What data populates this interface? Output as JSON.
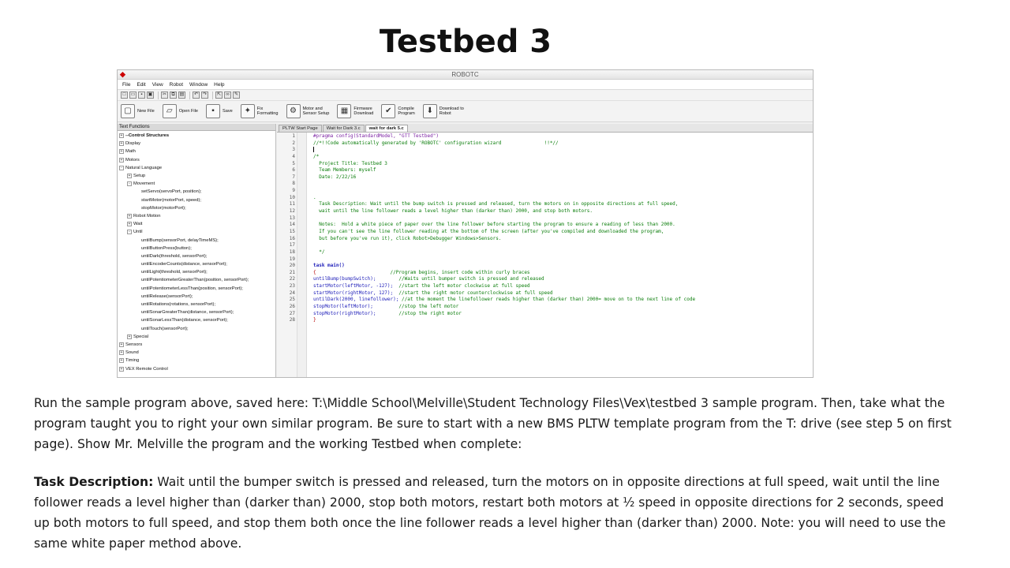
{
  "slide": {
    "title": "Testbed 3"
  },
  "app": {
    "title": "ROBOTC",
    "menu": [
      "File",
      "Edit",
      "View",
      "Robot",
      "Window",
      "Help"
    ],
    "toolbar_buttons": [
      {
        "label": "New File",
        "icon": "new-file-icon"
      },
      {
        "label": "Open File",
        "icon": "open-file-icon"
      },
      {
        "label": "Save",
        "icon": "save-icon"
      },
      {
        "label": "Fix\nFormatting",
        "icon": "fix-formatting-icon"
      },
      {
        "label": "Motor and\nSensor Setup",
        "icon": "motor-sensor-icon"
      },
      {
        "label": "Firmware\nDownload",
        "icon": "firmware-icon"
      },
      {
        "label": "Compile\nProgram",
        "icon": "compile-icon"
      },
      {
        "label": "Download to\nRobot",
        "icon": "download-icon"
      }
    ],
    "panel_header": "Text Functions",
    "tree": [
      {
        "label": "--Control Structures",
        "indent": 0,
        "toggle": "+",
        "bold": true
      },
      {
        "label": "Display",
        "indent": 0,
        "toggle": "+"
      },
      {
        "label": "Math",
        "indent": 0,
        "toggle": "+"
      },
      {
        "label": "Motors",
        "indent": 0,
        "toggle": "+"
      },
      {
        "label": "Natural Language",
        "indent": 0,
        "toggle": "-"
      },
      {
        "label": "Setup",
        "indent": 1,
        "toggle": "+"
      },
      {
        "label": "Movement",
        "indent": 1,
        "toggle": "-"
      },
      {
        "label": "setServo(servoPort, position);",
        "indent": 2,
        "toggle": ""
      },
      {
        "label": "startMotor(motorPort, speed);",
        "indent": 2,
        "toggle": ""
      },
      {
        "label": "stopMotor(motorPort);",
        "indent": 2,
        "toggle": ""
      },
      {
        "label": "Robot Motion",
        "indent": 1,
        "toggle": "+"
      },
      {
        "label": "Wait",
        "indent": 1,
        "toggle": "+"
      },
      {
        "label": "Until",
        "indent": 1,
        "toggle": "-"
      },
      {
        "label": "untilBump(sensorPort, delayTimeMS);",
        "indent": 2,
        "toggle": ""
      },
      {
        "label": "untilButtonPress(button);",
        "indent": 2,
        "toggle": ""
      },
      {
        "label": "untilDark(threshold, sensorPort);",
        "indent": 2,
        "toggle": ""
      },
      {
        "label": "untilEncoderCounts(distance, sensorPort);",
        "indent": 2,
        "toggle": ""
      },
      {
        "label": "untilLight(threshold, sensorPort);",
        "indent": 2,
        "toggle": ""
      },
      {
        "label": "untilPotentiometerGreaterThan(position, sensorPort);",
        "indent": 2,
        "toggle": ""
      },
      {
        "label": "untilPotentiometerLessThan(position, sensorPort);",
        "indent": 2,
        "toggle": ""
      },
      {
        "label": "untilRelease(sensorPort);",
        "indent": 2,
        "toggle": ""
      },
      {
        "label": "untilRotations(rotations, sensorPort);",
        "indent": 2,
        "toggle": ""
      },
      {
        "label": "untilSonarGreaterThan(distance, sensorPort);",
        "indent": 2,
        "toggle": ""
      },
      {
        "label": "untilSonarLessThan(distance, sensorPort);",
        "indent": 2,
        "toggle": ""
      },
      {
        "label": "untilTouch(sensorPort);",
        "indent": 2,
        "toggle": ""
      },
      {
        "label": "Special",
        "indent": 1,
        "toggle": "+"
      },
      {
        "label": "Sensors",
        "indent": 0,
        "toggle": "+"
      },
      {
        "label": "Sound",
        "indent": 0,
        "toggle": "+"
      },
      {
        "label": "Timing",
        "indent": 0,
        "toggle": "+"
      },
      {
        "label": "VEX Remote Control",
        "indent": 0,
        "toggle": "+"
      }
    ],
    "tabs": [
      {
        "label": "PLTW Start Page",
        "active": false
      },
      {
        "label": "Wait for Dark 3.c",
        "active": false
      },
      {
        "label": "wait for dark 5.c",
        "active": true
      }
    ],
    "code": [
      {
        "n": "1",
        "cls": "k-directive",
        "text": "#pragma config(StandardModel, \"GTT Testbed\")"
      },
      {
        "n": "2",
        "cls": "k-comment",
        "text": "//*!!Code automatically generated by 'ROBOTC' configuration wizard               !!*//"
      },
      {
        "n": "3",
        "cls": "cursor",
        "text": ""
      },
      {
        "n": "4",
        "cls": "k-comment",
        "text": "/*"
      },
      {
        "n": "5",
        "cls": "k-comment",
        "text": "  Project Title: Testbed 3"
      },
      {
        "n": "6",
        "cls": "k-comment",
        "text": "  Team Members: myself"
      },
      {
        "n": "7",
        "cls": "k-comment",
        "text": "  Date: 2/22/16"
      },
      {
        "n": "8",
        "cls": "k-comment",
        "text": ""
      },
      {
        "n": "9",
        "cls": "k-comment",
        "text": ""
      },
      {
        "n": "10",
        "cls": "k-comment",
        "text": "."
      },
      {
        "n": "11",
        "cls": "k-comment",
        "text": "  Task Description: Wait until the bump switch is pressed and released, turn the motors on in opposite directions at full speed,"
      },
      {
        "n": "12",
        "cls": "k-comment",
        "text": "  wait until the line follower reads a level higher than (darker than) 2000, and stop both motors."
      },
      {
        "n": "13",
        "cls": "k-comment",
        "text": ""
      },
      {
        "n": "14",
        "cls": "k-comment",
        "text": "  Notes:  Hold a white piece of paper over the line follower before starting the program to ensure a reading of less than 2000."
      },
      {
        "n": "15",
        "cls": "k-comment",
        "text": "  If you can't see the line follower reading at the bottom of the screen (after you've compiled and downloaded the program,"
      },
      {
        "n": "16",
        "cls": "k-comment",
        "text": "  but before you've run it), click Robot>Debugger Windows>Sensors."
      },
      {
        "n": "17",
        "cls": "k-comment",
        "text": ""
      },
      {
        "n": "18",
        "cls": "k-comment",
        "text": "  */"
      },
      {
        "n": "19",
        "cls": "k-comment",
        "text": ""
      },
      {
        "n": "20",
        "cls": "k-keyword",
        "text": "task main()"
      },
      {
        "n": "21",
        "cls": "mixed",
        "code": "{",
        "comment": "                          //Program begins, insert code within curly braces"
      },
      {
        "n": "22",
        "cls": "mixed",
        "code": "untilBump(bumpSwitch);",
        "comment": "        //Waits until bumper switch is pressed and released"
      },
      {
        "n": "23",
        "cls": "mixed",
        "code": "startMotor(leftMotor, -127);",
        "comment": "  //start the left motor clockwise at full speed"
      },
      {
        "n": "24",
        "cls": "mixed",
        "code": "startMotor(rightMotor, 127);",
        "comment": "  //start the right motor counterclockwise at full speed"
      },
      {
        "n": "25",
        "cls": "mixed",
        "code": "untilDark(2000, linefollower);",
        "comment": " //at the moment the linefollower reads higher than (darker than) 2000= move on to the next line of code"
      },
      {
        "n": "26",
        "cls": "mixed",
        "code": "stopMotor(leftMotor);",
        "comment": "         //stop the left motor"
      },
      {
        "n": "27",
        "cls": "mixed",
        "code": "stopMotor(rightMotor);",
        "comment": "        //stop the right motor"
      },
      {
        "n": "28",
        "cls": "k-plain",
        "text": "}"
      }
    ]
  },
  "body": {
    "para1": "Run the sample program above, saved here:  T:\\Middle School\\Melville\\Student Technology Files\\Vex\\testbed 3 sample program. Then, take what the program taught you to right your own similar program.  Be sure to start with a new BMS PLTW template program from the T: drive (see step 5 on first page). Show Mr. Melville the program and the working Testbed when complete:",
    "task_label": "Task Description:",
    "task_text": "  Wait until the bumper switch is pressed and released, turn the motors on in opposite directions at full speed, wait until the line follower reads a level higher than (darker than) 2000, stop both motors, restart both motors at ½ speed in opposite directions for 2 seconds, speed up both motors to full speed, and stop them both once the line follower reads a level higher than (darker than) 2000.  Note:  you will need to use the same white paper method above."
  }
}
